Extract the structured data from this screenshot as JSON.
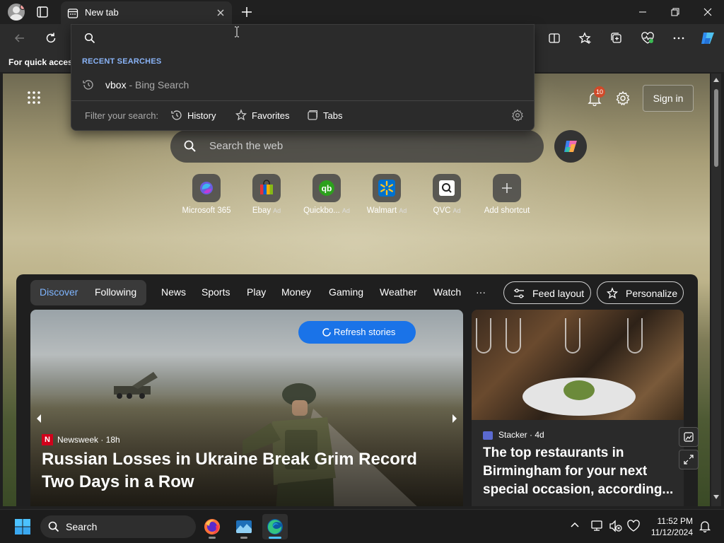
{
  "tab": {
    "title": "New tab"
  },
  "favorites_bar": {
    "text": "For quick access"
  },
  "address_dropdown": {
    "recent_header": "RECENT SEARCHES",
    "recent_items": [
      {
        "query": "vbox",
        "source": "- Bing Search"
      }
    ],
    "filter_label": "Filter your search:",
    "filters": [
      "History",
      "Favorites",
      "Tabs"
    ]
  },
  "newtab": {
    "notification_count": "10",
    "sign_in": "Sign in",
    "search_placeholder": "Search the web",
    "shortcuts": [
      {
        "label": "Microsoft 365",
        "ad": ""
      },
      {
        "label": "Ebay",
        "ad": "Ad"
      },
      {
        "label": "Quickbo...",
        "ad": "Ad"
      },
      {
        "label": "Walmart",
        "ad": "Ad"
      },
      {
        "label": "QVC",
        "ad": "Ad"
      },
      {
        "label": "Add shortcut",
        "ad": ""
      }
    ]
  },
  "feed": {
    "tabs": [
      "Discover",
      "Following"
    ],
    "categories": [
      "News",
      "Sports",
      "Play",
      "Money",
      "Gaming",
      "Weather",
      "Watch",
      "···"
    ],
    "feed_layout": "Feed layout",
    "personalize": "Personalize",
    "refresh": "Refresh stories",
    "main_story": {
      "source": "Newsweek · 18h",
      "logo": "N",
      "title": "Russian Losses in Ukraine Break Grim Record Two Days in a Row"
    },
    "side_story": {
      "source": "Stacker · 4d",
      "title": "The top restaurants in Birmingham for your next special occasion, according..."
    }
  },
  "taskbar": {
    "search": "Search",
    "time": "11:52 PM",
    "date": "11/12/2024"
  },
  "colors": {
    "accent": "#1a73e8",
    "link": "#8ab4f8",
    "discover": "#7fb5ff"
  }
}
